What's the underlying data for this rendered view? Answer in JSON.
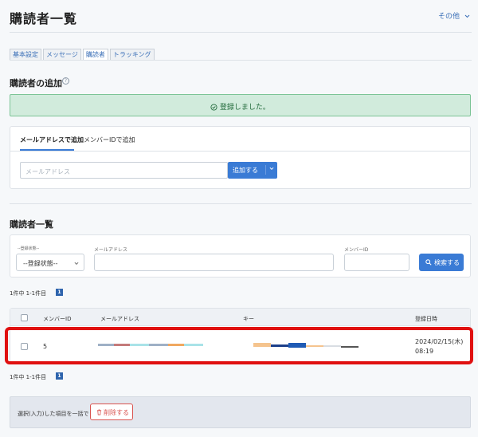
{
  "header": {
    "title": "購読者一覧",
    "other_menu": "その他"
  },
  "tabs": [
    "基本設定",
    "メッセージ",
    "購読者",
    "トラッキング"
  ],
  "add_section": {
    "title": "購読者の追加",
    "success_message": "登録しました。",
    "subtabs": [
      "メールアドレスで追加",
      "メンバーIDで追加"
    ],
    "email_placeholder": "メールアドレス",
    "add_button": "追加する"
  },
  "list_section": {
    "title": "購読者一覧",
    "filters": {
      "status_label": "--登録状態--",
      "status_value": "--登録状態--",
      "email_label": "メールアドレス",
      "member_id_label": "メンバーID",
      "search_button": "検索する"
    },
    "count_text": "1件中 1-1件目",
    "page": "1",
    "table": {
      "headers": [
        "メンバーID",
        "メールアドレス",
        "キー",
        "登録日時"
      ],
      "rows": [
        {
          "member_id": "5",
          "date": "2024/02/15(木)",
          "time": "08:19"
        }
      ]
    },
    "count_text_bottom": "1件中 1-1件目",
    "page_bottom": "1"
  },
  "bulk_bar": {
    "text": "選択(入力)した項目を一括で",
    "delete_button": "削除する"
  },
  "colors": {
    "accent": "#3a7bd5",
    "success_bg": "#d1ebdc",
    "danger": "#d9534f",
    "highlight": "#e01010"
  }
}
